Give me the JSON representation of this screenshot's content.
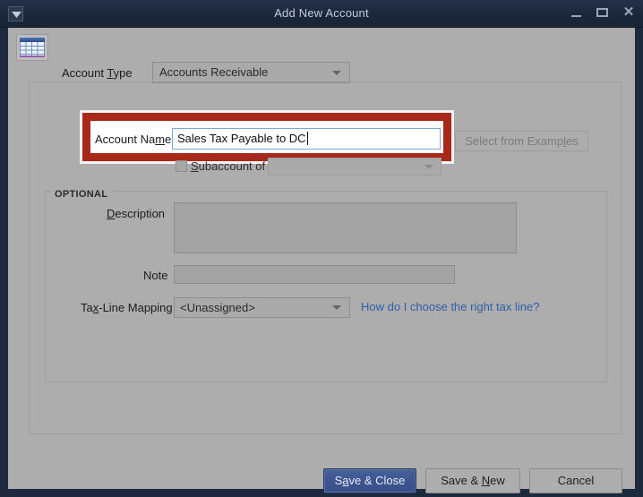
{
  "window": {
    "title": "Add New Account",
    "sysmenu_icon": "window-menu-icon",
    "minimize_icon": "minimize-icon",
    "maximize_icon": "maximize-icon",
    "close_icon": "close-icon",
    "close_glyph": "✕"
  },
  "header": {
    "account_icon": "spreadsheet-icon",
    "account_type_label_pre": "Account ",
    "account_type_label_key": "T",
    "account_type_label_post": "ype",
    "account_type_value": "Accounts Receivable"
  },
  "form": {
    "account_name_label_pre": "Account Na",
    "account_name_label_key": "m",
    "account_name_label_post": "e",
    "account_name_value": "Sales Tax Payable to DC",
    "select_examples_pre": "Select from Examp",
    "select_examples_key": "l",
    "select_examples_post": "es",
    "subaccount_label_key": "S",
    "subaccount_label_post": "ubaccount of",
    "subaccount_checked": false,
    "subaccount_value": ""
  },
  "optional": {
    "legend": "OPTIONAL",
    "description_label_key": "D",
    "description_label_post": "escription",
    "description_value": "",
    "note_label": "Note",
    "note_value": "",
    "taxline_label_pre": "Ta",
    "taxline_label_key": "x",
    "taxline_label_post": "-Line Mapping",
    "taxline_value": "<Unassigned>",
    "taxline_link": "How do I choose the right tax line?"
  },
  "footer": {
    "save_close_pre": "S",
    "save_close_key": "a",
    "save_close_post": "ve & Close",
    "save_new_pre": "Save & ",
    "save_new_key": "N",
    "save_new_post": "ew",
    "cancel": "Cancel"
  },
  "colors": {
    "titlebar": "#1d2a3e",
    "dialog_bg": "#adadad",
    "annotation_red": "#a8291a",
    "primary_button": "#3c5490",
    "link_blue": "#2f5fa8",
    "focus_border": "#7ba7d7"
  }
}
